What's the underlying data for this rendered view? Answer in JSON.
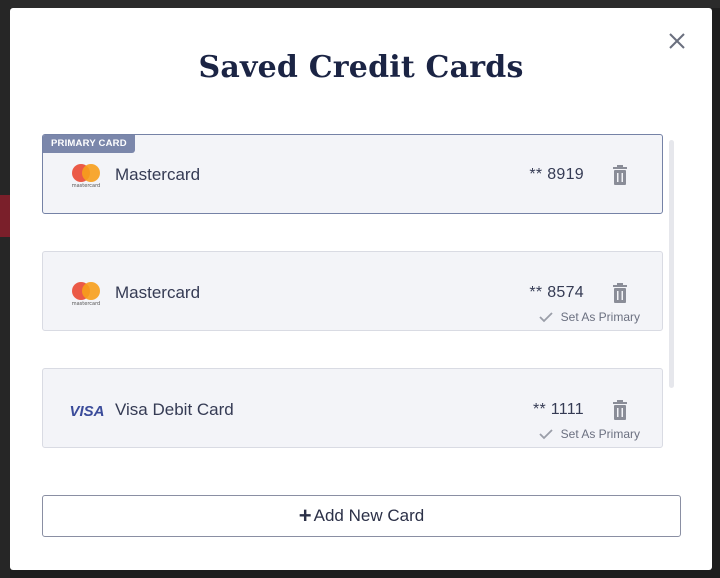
{
  "modal": {
    "title": "Saved Credit Cards",
    "close_icon": "close-icon"
  },
  "primary_badge": "PRIMARY CARD",
  "cards": [
    {
      "name": "Mastercard",
      "number": "** 8919",
      "brand": "mastercard",
      "brand_text": "mastercard",
      "is_primary": true
    },
    {
      "name": "Mastercard",
      "number": "** 8574",
      "brand": "mastercard",
      "brand_text": "mastercard",
      "is_primary": false,
      "set_primary_label": "Set As Primary"
    },
    {
      "name": "Visa Debit Card",
      "number": "** 1111",
      "brand": "visa",
      "brand_text": "VISA",
      "is_primary": false,
      "set_primary_label": "Set As Primary"
    }
  ],
  "add_button": {
    "plus": "+",
    "label": "Add New Card"
  },
  "colors": {
    "title": "#1b2444",
    "primary_badge_bg": "#7b87ab",
    "mastercard_red": "#eb5a47",
    "mastercard_orange": "#f79e1b",
    "visa_blue": "#3a4b9a"
  }
}
